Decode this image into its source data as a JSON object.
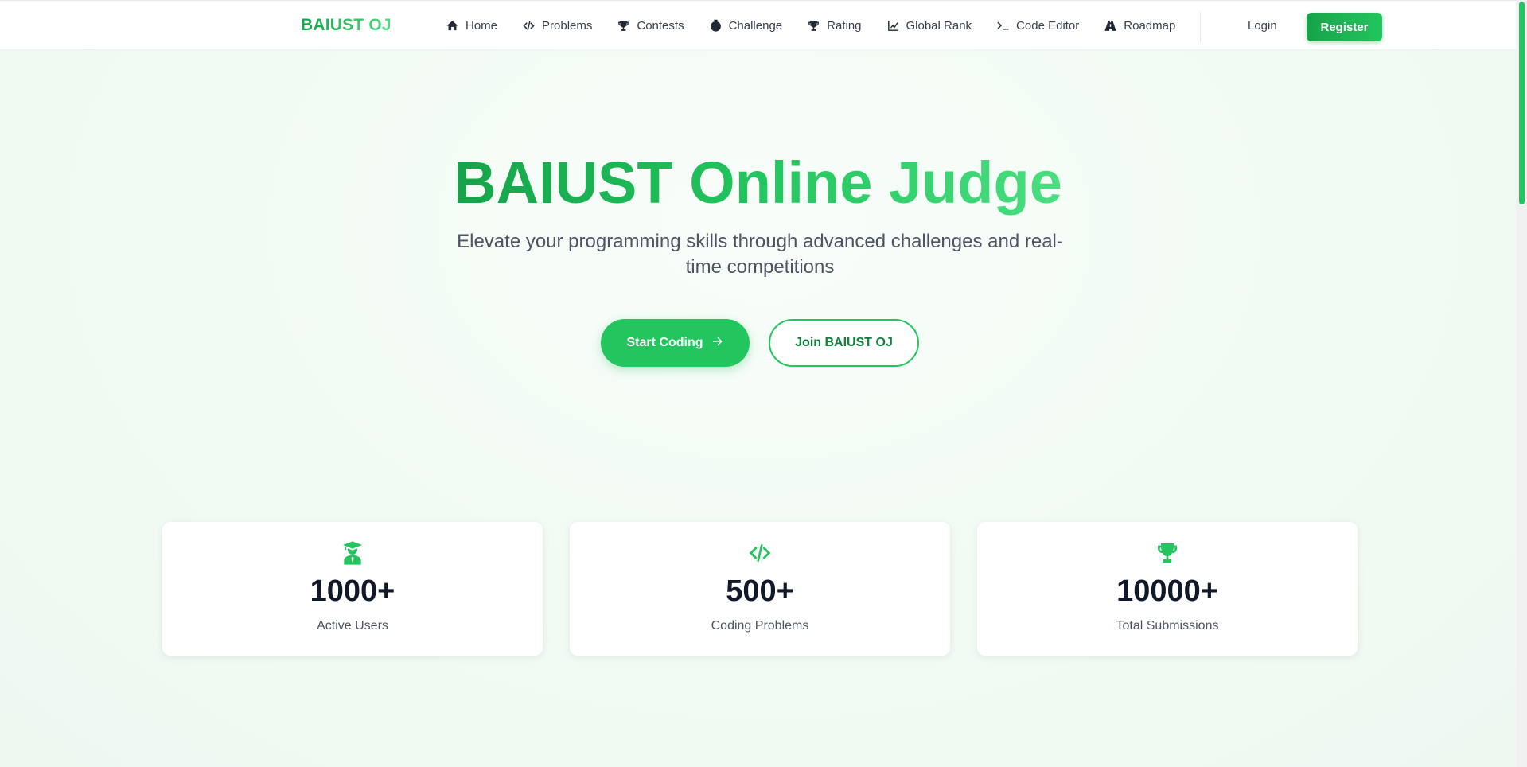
{
  "brand": "BAIUST OJ",
  "nav": {
    "items": [
      {
        "label": "Home",
        "icon": "home-icon"
      },
      {
        "label": "Problems",
        "icon": "code-icon"
      },
      {
        "label": "Contests",
        "icon": "trophy-icon"
      },
      {
        "label": "Challenge",
        "icon": "stopwatch-icon"
      },
      {
        "label": "Rating",
        "icon": "trophy-icon"
      },
      {
        "label": "Global Rank",
        "icon": "chart-line-icon"
      },
      {
        "label": "Code Editor",
        "icon": "terminal-icon"
      },
      {
        "label": "Roadmap",
        "icon": "road-icon"
      }
    ],
    "login": "Login",
    "register": "Register"
  },
  "hero": {
    "title": "BAIUST Online Judge",
    "subtitle": "Elevate your programming skills through advanced challenges and real-time competitions",
    "primary_button": "Start Coding",
    "secondary_button": "Join BAIUST OJ"
  },
  "stats": [
    {
      "value": "1000+",
      "label": "Active Users",
      "icon": "user-graduate-icon"
    },
    {
      "value": "500+",
      "label": "Coding Problems",
      "icon": "code-icon"
    },
    {
      "value": "10000+",
      "label": "Total Submissions",
      "icon": "trophy-icon"
    }
  ],
  "colors": {
    "accent": "#22c55e",
    "accent_dark": "#16a34a",
    "background": "#f1faf3"
  }
}
